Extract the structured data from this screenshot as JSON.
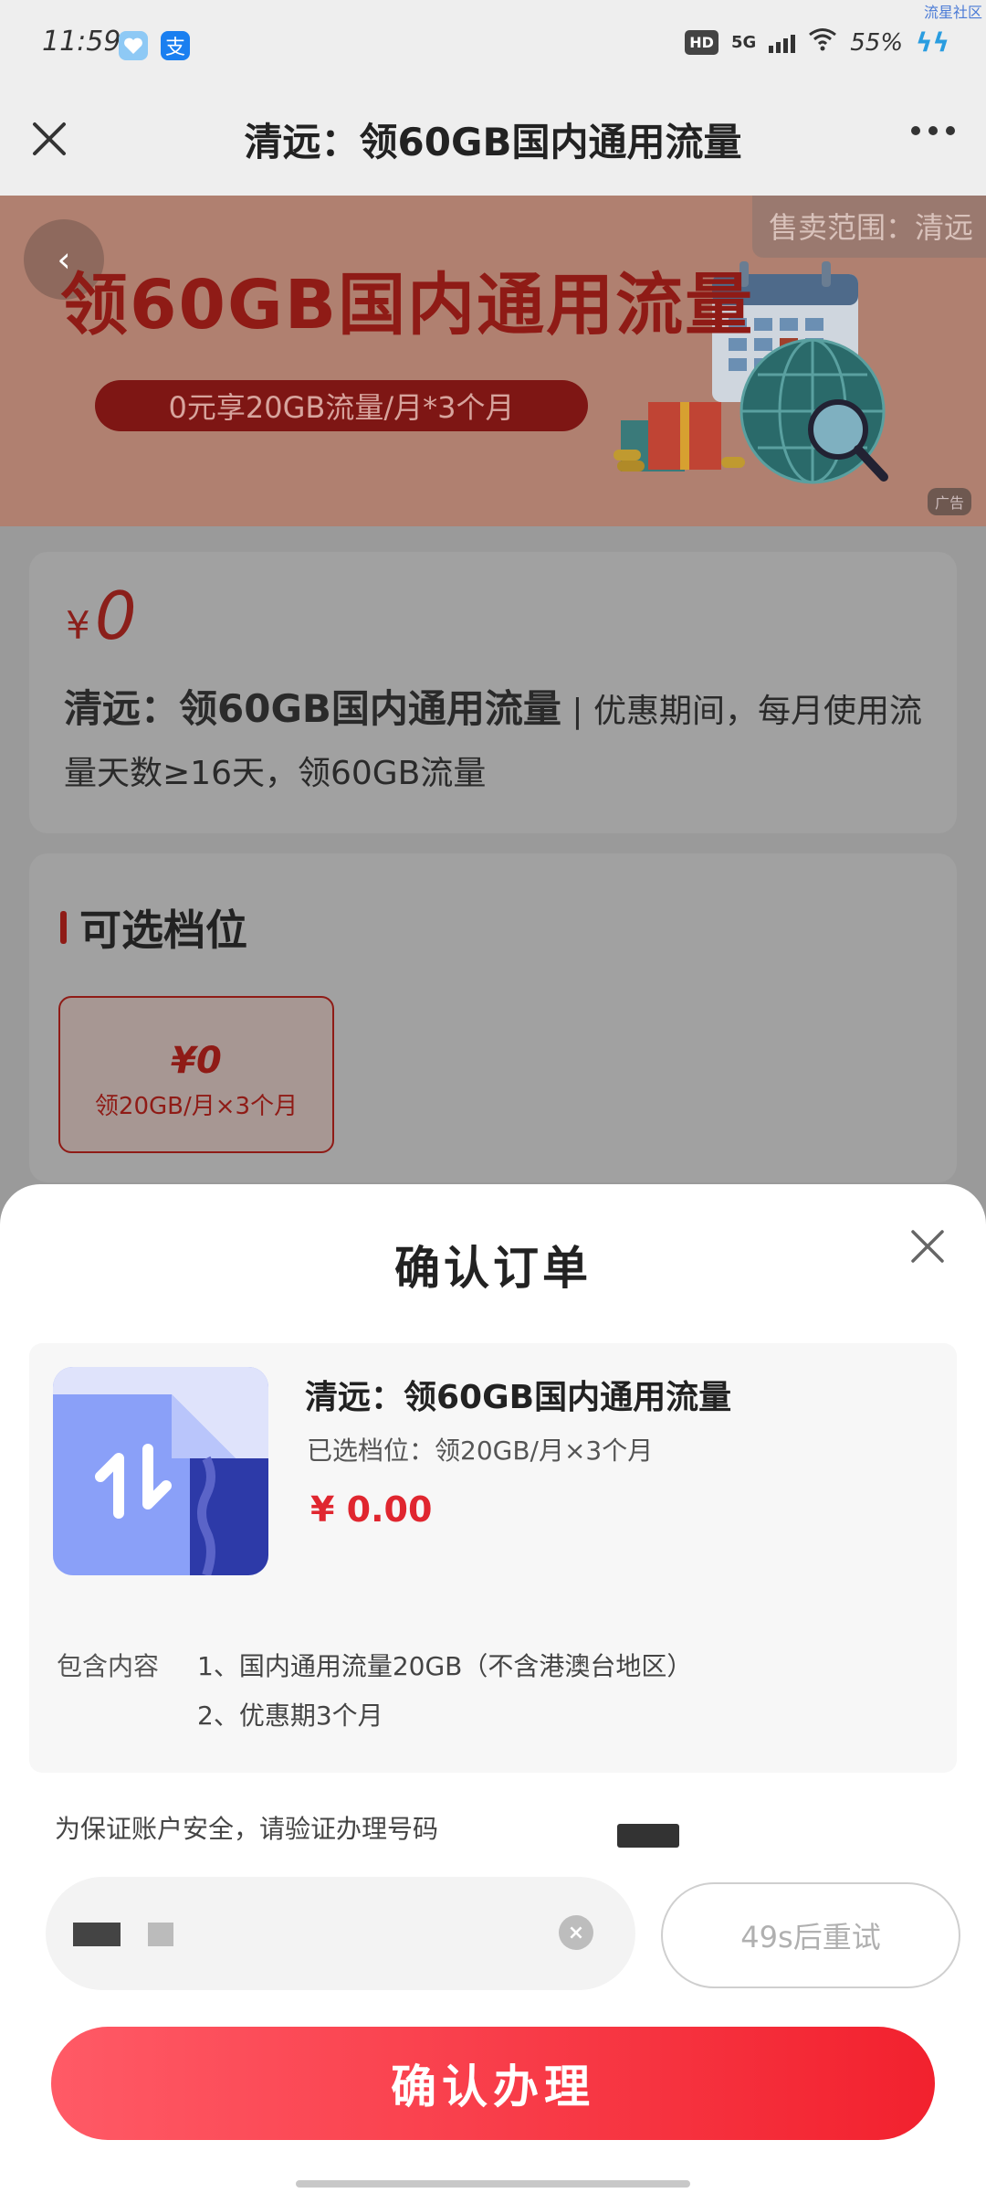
{
  "status_bar": {
    "time": "11:59",
    "network": "5G",
    "hd_badge": "HD",
    "battery": "55%",
    "corner_tag": "流星社区",
    "icons": [
      "heart-app-icon",
      "alipay-icon",
      "hd-icon",
      "signal-icon",
      "wifi-icon",
      "charging-icon"
    ]
  },
  "title_bar": {
    "title": "清远：领60GB国内通用流量"
  },
  "banner": {
    "region": "售卖范围：清远",
    "headline": "领60GB国内通用流量",
    "pill": "0元享20GB流量/月*3个月",
    "ad_tag": "广告"
  },
  "product": {
    "currency": "¥",
    "price": "0",
    "name": "清远：领60GB国内通用流量",
    "separator": "|",
    "description": "优惠期间，每月使用流量天数≥16天，领60GB流量"
  },
  "tiers": {
    "section_title": "可选档位",
    "items": [
      {
        "price": "¥0",
        "label": "领20GB/月×3个月"
      }
    ]
  },
  "sheet": {
    "title": "确认订单",
    "order": {
      "name": "清远：领60GB国内通用流量",
      "selected_tier": "已选档位：领20GB/月×3个月",
      "price": "¥ 0.00",
      "includes_label": "包含内容",
      "includes": [
        "1、国内通用流量20GB（不含港澳台地区）",
        "2、优惠期3个月"
      ]
    },
    "verify_note": "为保证账户安全，请验证办理号码",
    "retry_label": "49s后重试",
    "confirm_label": "确认办理"
  },
  "colors": {
    "accent_red": "#e0262f",
    "button_gradient_start": "#ff5a66",
    "button_gradient_end": "#f2212e",
    "overlay_gray": "#9a9a9a"
  }
}
